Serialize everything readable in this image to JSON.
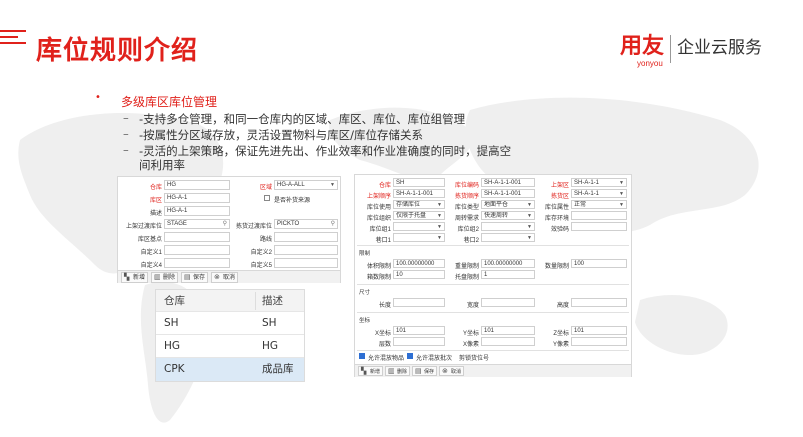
{
  "slide": {
    "title": "库位规则介绍",
    "logo": {
      "brand": "用友",
      "brand_sub": "yonyou",
      "service": "企业云服务"
    },
    "bullet": {
      "heading": "多级库区库位管理",
      "items": [
        "-支持多仓管理，和同一仓库内的区域、库区、库位、库位组管理",
        "-按属性分区域存放，灵活设置物料与库区/库位存储关系",
        "-灵活的上架策略，保证先进先出、作业效率和作业准确度的同时，提高空",
        "间利用率"
      ]
    }
  },
  "left_form": {
    "fields": {
      "warehouse_label": "仓库",
      "warehouse_value": "HG",
      "region_label": "区域",
      "region_value": "HG-A-ALL",
      "zone_label": "库区",
      "zone_value": "HG-A-1",
      "replenish_label": "是否补货来源",
      "desc_label": "描述",
      "desc_value": "HG-A-1",
      "putaway_label": "上架过渡库位",
      "putaway_value": "STAGE",
      "picking_label": "拣货过渡库位",
      "picking_value": "PICKTO",
      "zone_base_label": "库区基点",
      "path_label": "路线",
      "custom1_label": "自定义1",
      "custom2_label": "自定义2",
      "custom4_label": "自定义4",
      "custom5_label": "自定义5"
    },
    "toolbar": {
      "new": "新增",
      "delete": "删除",
      "save": "保存",
      "cancel": "取消"
    }
  },
  "dropdown_table": {
    "headers": [
      "仓库",
      "描述"
    ],
    "rows": [
      [
        "SH",
        "SH"
      ],
      [
        "HG",
        "HG"
      ],
      [
        "CPK",
        "成品库"
      ]
    ]
  },
  "right_form": {
    "top": {
      "warehouse_label": "仓库",
      "warehouse_value": "SH",
      "loc_code_label": "库位编码",
      "loc_code_value": "SH-A-1-1-001",
      "zone_label": "上架区",
      "zone_value": "SH-A-1-1",
      "putaway_seq_label": "上架顺序",
      "putaway_seq_value": "SH-A-1-1-001",
      "pick_seq_label": "拣货顺序",
      "pick_seq_value": "SH-A-1-1-001",
      "pick_zone_label": "拣货区",
      "pick_zone_value": "SH-A-1-1",
      "loc_use_label": "库位使用",
      "loc_use_value": "存储库位",
      "loc_type_label": "库位类型",
      "loc_type_value": "地面平仓",
      "loc_attr_label": "库位属性",
      "loc_attr_value": "正常",
      "loc_org_label": "库位组织",
      "loc_org_value": "仅限于托盘",
      "turnover_label": "周转需求",
      "turnover_value": "快速周转",
      "env_label": "库存环境",
      "loc_group1_label": "库位组1",
      "loc_group2_label": "库位组2",
      "check_label": "效验码",
      "lane1_label": "巷口1",
      "lane2_label": "巷口2"
    },
    "limits": {
      "section": "限制",
      "volume_label": "体积限制",
      "volume_value": "100.00000000",
      "weight_label": "重量限制",
      "weight_value": "100.00000000",
      "qty_label": "数量限制",
      "qty_value": "100",
      "box_label": "箱数限制",
      "box_value": "10",
      "pallet_label": "托盘限制",
      "pallet_value": "1"
    },
    "size": {
      "section": "尺寸",
      "length_label": "长度",
      "width_label": "宽度",
      "height_label": "高度"
    },
    "coords": {
      "section": "坐标",
      "x_label": "X坐标",
      "x_value": "101",
      "y_label": "Y坐标",
      "y_value": "101",
      "z_label": "Z坐标",
      "z_value": "101",
      "layer_label": "层数",
      "xpix_label": "X像素",
      "ypix_label": "Y像素"
    },
    "checks": {
      "mix_sku": "允许混放物品",
      "mix_lot": "允许混放批次",
      "cargo_lock": "剪锁货位号"
    },
    "toolbar": {
      "new": "新增",
      "delete": "删除",
      "save": "保存",
      "cancel": "取消"
    }
  }
}
